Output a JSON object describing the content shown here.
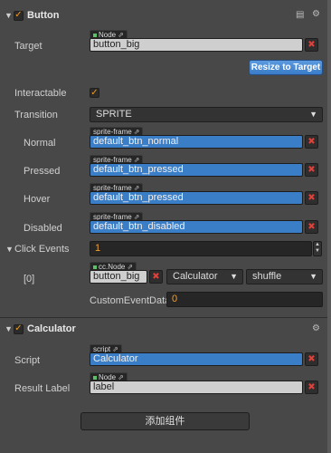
{
  "button_component": {
    "title": "Button",
    "target": {
      "label": "Target",
      "tag": "Node",
      "value": "button_big"
    },
    "resize_label": "Resize to Target",
    "interactable": {
      "label": "Interactable",
      "checked": true
    },
    "transition": {
      "label": "Transition",
      "value": "SPRITE"
    },
    "normal": {
      "label": "Normal",
      "tag": "sprite-frame",
      "value": "default_btn_normal"
    },
    "pressed": {
      "label": "Pressed",
      "tag": "sprite-frame",
      "value": "default_btn_pressed"
    },
    "hover": {
      "label": "Hover",
      "tag": "sprite-frame",
      "value": "default_btn_pressed"
    },
    "disabled": {
      "label": "Disabled",
      "tag": "sprite-frame",
      "value": "default_btn_disabled"
    },
    "click_events": {
      "label": "Click Events",
      "count": "1",
      "item": {
        "index_label": "[0]",
        "tag": "cc.Node",
        "target": "button_big",
        "component": "Calculator",
        "handler": "shuffle",
        "custom_label": "CustomEventData",
        "custom_value": "0"
      }
    }
  },
  "calculator_component": {
    "title": "Calculator",
    "script": {
      "label": "Script",
      "tag": "script",
      "value": "Calculator"
    },
    "result_label": {
      "label": "Result Label",
      "tag": "Node",
      "value": "label"
    }
  },
  "add_component_label": "添加组件"
}
